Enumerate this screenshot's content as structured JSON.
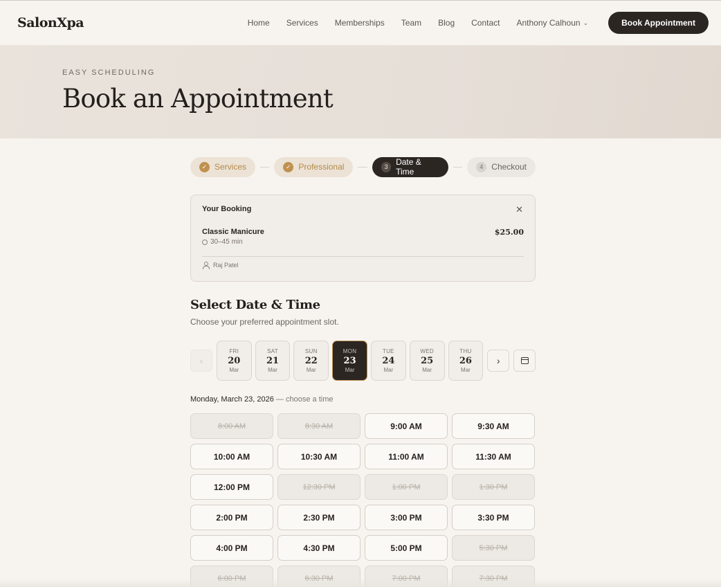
{
  "header": {
    "brand": "SalonXpa",
    "nav": [
      "Home",
      "Services",
      "Memberships",
      "Team",
      "Blog",
      "Contact"
    ],
    "user_name": "Anthony Calhoun",
    "book_button": "Book Appointment"
  },
  "hero": {
    "eyebrow": "EASY SCHEDULING",
    "title": "Book an Appointment"
  },
  "steps": [
    {
      "num": "✓",
      "label": "Services",
      "state": "done"
    },
    {
      "num": "✓",
      "label": "Professional",
      "state": "done"
    },
    {
      "num": "3",
      "label": "Date & Time",
      "state": "active"
    },
    {
      "num": "4",
      "label": "Checkout",
      "state": "todo"
    }
  ],
  "booking": {
    "title": "Your Booking",
    "close_symbol": "✕",
    "service_name": "Classic Manicure",
    "price": "$25.00",
    "duration": "30–45 min",
    "professional": "Raj Patel"
  },
  "datetime": {
    "heading": "Select Date & Time",
    "subheading": "Choose your preferred appointment slot.",
    "prev_arrow": "‹",
    "next_arrow": "›",
    "days": [
      {
        "dow": "FRI",
        "num": "20",
        "mon": "Mar",
        "selected": false
      },
      {
        "dow": "SAT",
        "num": "21",
        "mon": "Mar",
        "selected": false
      },
      {
        "dow": "SUN",
        "num": "22",
        "mon": "Mar",
        "selected": false
      },
      {
        "dow": "MON",
        "num": "23",
        "mon": "Mar",
        "selected": true
      },
      {
        "dow": "TUE",
        "num": "24",
        "mon": "Mar",
        "selected": false
      },
      {
        "dow": "WED",
        "num": "25",
        "mon": "Mar",
        "selected": false
      },
      {
        "dow": "THU",
        "num": "26",
        "mon": "Mar",
        "selected": false
      }
    ],
    "selected_date_label": "Monday, March 23, 2026",
    "selected_date_hint": " — choose a time",
    "slots": [
      {
        "time": "8:00 AM",
        "available": false
      },
      {
        "time": "8:30 AM",
        "available": false
      },
      {
        "time": "9:00 AM",
        "available": true
      },
      {
        "time": "9:30 AM",
        "available": true
      },
      {
        "time": "10:00 AM",
        "available": true
      },
      {
        "time": "10:30 AM",
        "available": true
      },
      {
        "time": "11:00 AM",
        "available": true
      },
      {
        "time": "11:30 AM",
        "available": true
      },
      {
        "time": "12:00 PM",
        "available": true
      },
      {
        "time": "12:30 PM",
        "available": false
      },
      {
        "time": "1:00 PM",
        "available": false
      },
      {
        "time": "1:30 PM",
        "available": false
      },
      {
        "time": "2:00 PM",
        "available": true
      },
      {
        "time": "2:30 PM",
        "available": true
      },
      {
        "time": "3:00 PM",
        "available": true
      },
      {
        "time": "3:30 PM",
        "available": true
      },
      {
        "time": "4:00 PM",
        "available": true
      },
      {
        "time": "4:30 PM",
        "available": true
      },
      {
        "time": "5:00 PM",
        "available": true
      },
      {
        "time": "5:30 PM",
        "available": false
      },
      {
        "time": "6:00 PM",
        "available": false
      },
      {
        "time": "6:30 PM",
        "available": false
      },
      {
        "time": "7:00 PM",
        "available": false
      },
      {
        "time": "7:30 PM",
        "available": false
      }
    ]
  },
  "colors": {
    "background": "#f7f4f0",
    "dark": "#2c2623",
    "accent_gold": "#bf9150",
    "hero_bg": "#e6dfd8"
  }
}
